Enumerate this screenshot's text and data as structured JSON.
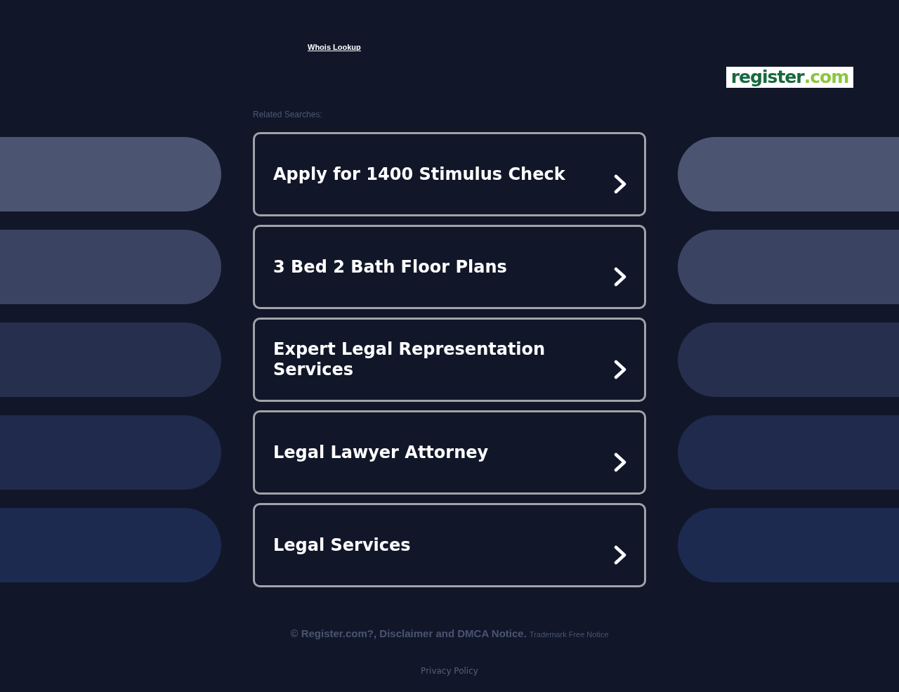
{
  "header": {
    "whois_link": "Whois Lookup",
    "logo": {
      "name": "register",
      "suffix": ".com"
    }
  },
  "related": {
    "heading": "Related Searches:",
    "links": [
      "Apply for 1400 Stimulus Check",
      "3 Bed 2 Bath Floor Plans",
      "Expert Legal Representation Services",
      "Legal Lawyer Attorney",
      "Legal Services"
    ]
  },
  "footer": {
    "notice": "© Register.com?, Disclaimer and DMCA Notice.",
    "trademark": "Trademark Free Notice",
    "privacy": "Privacy Policy"
  }
}
